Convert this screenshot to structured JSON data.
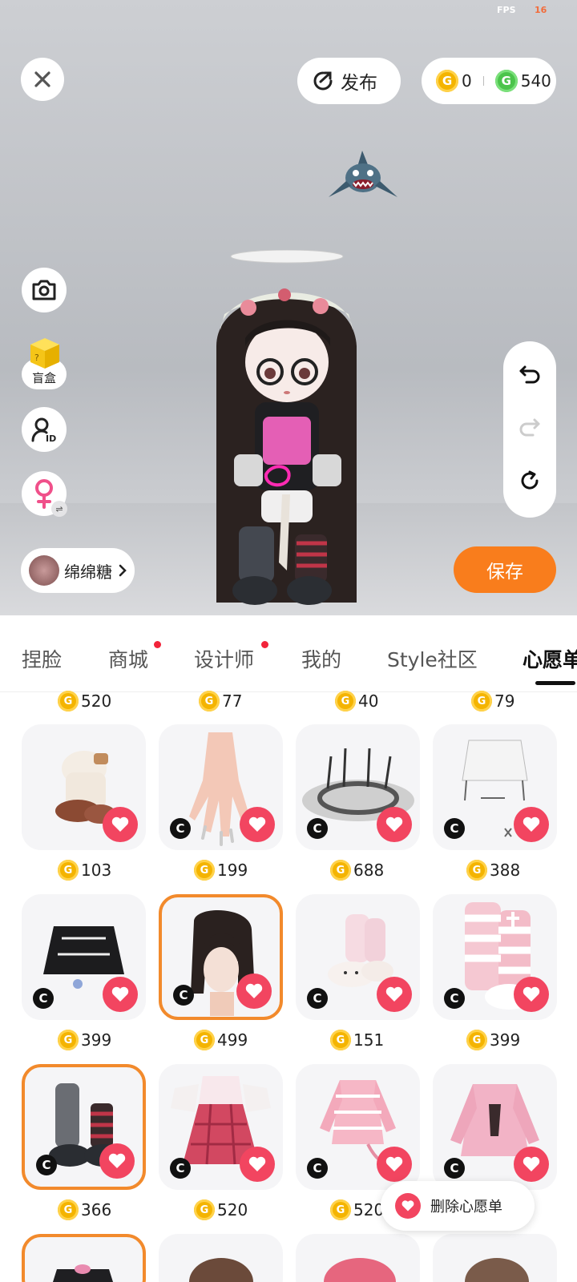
{
  "fps": {
    "label": "FPS",
    "value": "16"
  },
  "toolbar": {
    "publish_label": "发布",
    "gold_balance": "0",
    "green_balance": "540",
    "coin_glyph": "G"
  },
  "side": {
    "blind_box_label": "盲盒"
  },
  "user": {
    "nickname": "绵绵糖"
  },
  "actions": {
    "save_label": "保存",
    "delete_wishlist_label": "删除心愿单"
  },
  "tabs": [
    {
      "label": "捏脸",
      "has_dot": false
    },
    {
      "label": "商城",
      "has_dot": true
    },
    {
      "label": "设计师",
      "has_dot": true
    },
    {
      "label": "我的",
      "has_dot": false
    },
    {
      "label": "Style社区",
      "has_dot": false
    },
    {
      "label": "心愿单",
      "has_dot": false,
      "active": true
    }
  ],
  "top_prices": [
    "520",
    "77",
    "40",
    "79"
  ],
  "items": [
    {
      "name": "furry-boots",
      "price": "103",
      "creator_badge": false,
      "selected": false
    },
    {
      "name": "hand-nails",
      "price": "199",
      "creator_badge": true,
      "selected": false
    },
    {
      "name": "spike-halo",
      "price": "688",
      "creator_badge": true,
      "selected": false
    },
    {
      "name": "white-skirt",
      "price": "388",
      "creator_badge": true,
      "selected": false
    },
    {
      "name": "black-skirt",
      "price": "399",
      "creator_badge": true,
      "selected": false
    },
    {
      "name": "dark-hair",
      "price": "499",
      "creator_badge": true,
      "selected": true
    },
    {
      "name": "bunny-slippers",
      "price": "151",
      "creator_badge": true,
      "selected": false
    },
    {
      "name": "pink-striped-boots",
      "price": "399",
      "creator_badge": true,
      "selected": false
    },
    {
      "name": "gray-legwarmers",
      "price": "366",
      "creator_badge": true,
      "selected": true
    },
    {
      "name": "plaid-dress",
      "price": "520",
      "creator_badge": true,
      "selected": false
    },
    {
      "name": "pink-cardigan",
      "price": "520",
      "creator_badge": true,
      "selected": false
    },
    {
      "name": "pink-sweater",
      "price": "",
      "creator_badge": true,
      "selected": false
    }
  ],
  "colors": {
    "accent": "#f97d1c",
    "heart": "#f24560",
    "selected_border": "#f28a2c"
  }
}
